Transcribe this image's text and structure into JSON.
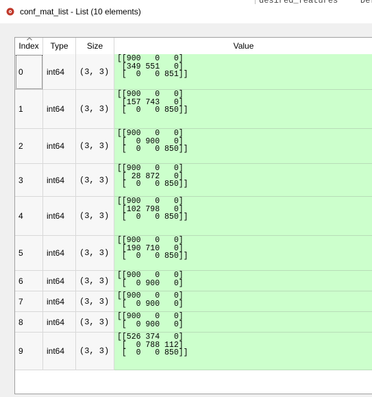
{
  "window": {
    "title": "conf_mat_list - List (10 elements)",
    "behind_text_1": "desired_features",
    "behind_text_2": "Def"
  },
  "table": {
    "columns": [
      "Index",
      "Type",
      "Size",
      "Value"
    ],
    "rows": [
      {
        "index": "0",
        "type": "int64",
        "size": "(3, 3)",
        "value": "[[900   0   0]\n [349 551   0]\n [  0   0 851]]"
      },
      {
        "index": "1",
        "type": "int64",
        "size": "(3, 3)",
        "value": "[[900   0   0]\n [157 743   0]\n [  0   0 850]]"
      },
      {
        "index": "2",
        "type": "int64",
        "size": "(3, 3)",
        "value": "[[900   0   0]\n [  0 900   0]\n [  0   0 850]]"
      },
      {
        "index": "3",
        "type": "int64",
        "size": "(3, 3)",
        "value": "[[900   0   0]\n [ 28 872   0]\n [  0   0 850]]"
      },
      {
        "index": "4",
        "type": "int64",
        "size": "(3, 3)",
        "value": "[[900   0   0]\n [102 798   0]\n [  0   0 850]]"
      },
      {
        "index": "5",
        "type": "int64",
        "size": "(3, 3)",
        "value": "[[900   0   0]\n [190 710   0]\n [  0   0 850]]"
      },
      {
        "index": "6",
        "type": "int64",
        "size": "(3, 3)",
        "value": "[[900   0   0]\n [  0 900   0]"
      },
      {
        "index": "7",
        "type": "int64",
        "size": "(3, 3)",
        "value": "[[900   0   0]\n [  0 900   0]"
      },
      {
        "index": "8",
        "type": "int64",
        "size": "(3, 3)",
        "value": "[[900   0   0]\n [  0 900   0]"
      },
      {
        "index": "9",
        "type": "int64",
        "size": "(3, 3)",
        "value": "[[526 374   0]\n [  0 788 112]\n [  0   0 850]]"
      }
    ]
  },
  "colors": {
    "value_background": "#ccffcc",
    "icon_red": "#c0392b"
  }
}
